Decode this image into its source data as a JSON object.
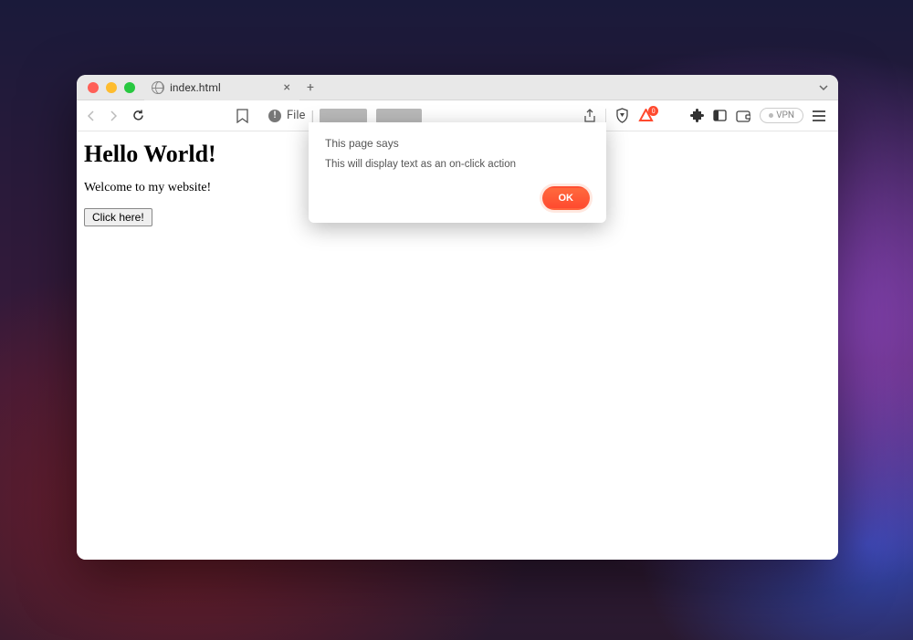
{
  "tab": {
    "title": "index.html"
  },
  "addressbar": {
    "protocol": "File"
  },
  "toolbar": {
    "vpn_label": "VPN",
    "brave_badge": "0"
  },
  "page": {
    "heading": "Hello World!",
    "paragraph": "Welcome to my website!",
    "button_label": "Click here!"
  },
  "alert": {
    "title": "This page says",
    "message": "This will display text as an on-click action",
    "ok_label": "OK"
  }
}
